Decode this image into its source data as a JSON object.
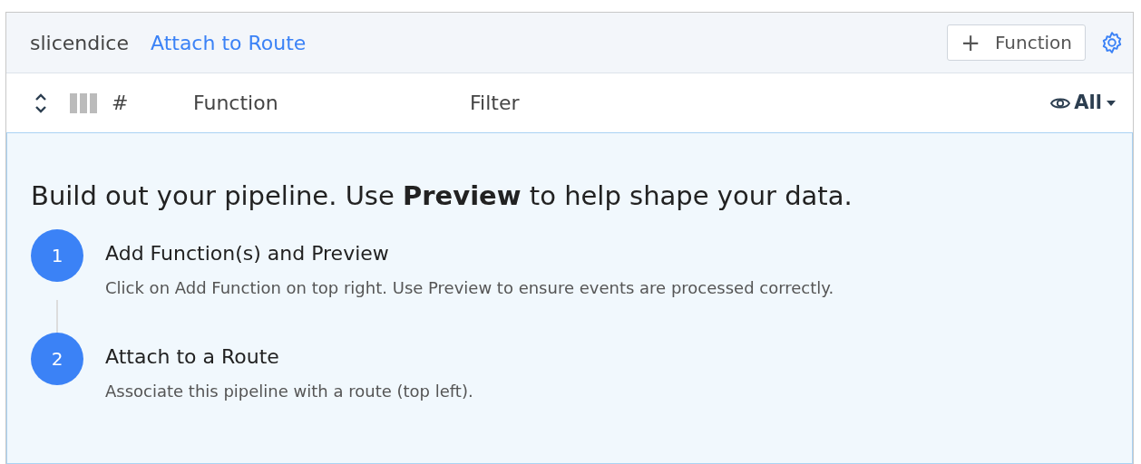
{
  "header": {
    "pipeline_name": "slicendice",
    "route_link": "Attach to Route",
    "add_button": {
      "icon": "+",
      "label": "Function"
    }
  },
  "columns": [
    "#",
    "Function",
    "Filter"
  ],
  "view_filter": {
    "label": "All"
  },
  "empty_state": {
    "headline": "Build out your pipeline. Use **Preview** to help shape your data.",
    "steps": [
      {
        "number": "1",
        "title": "Add Function(s) and Preview",
        "description": "Click on Add Function on top right. Use Preview to ensure events are processed correctly."
      },
      {
        "number": "2",
        "title": "Attach to a Route",
        "description": "Associate this pipeline with a route (top left)."
      }
    ]
  }
}
